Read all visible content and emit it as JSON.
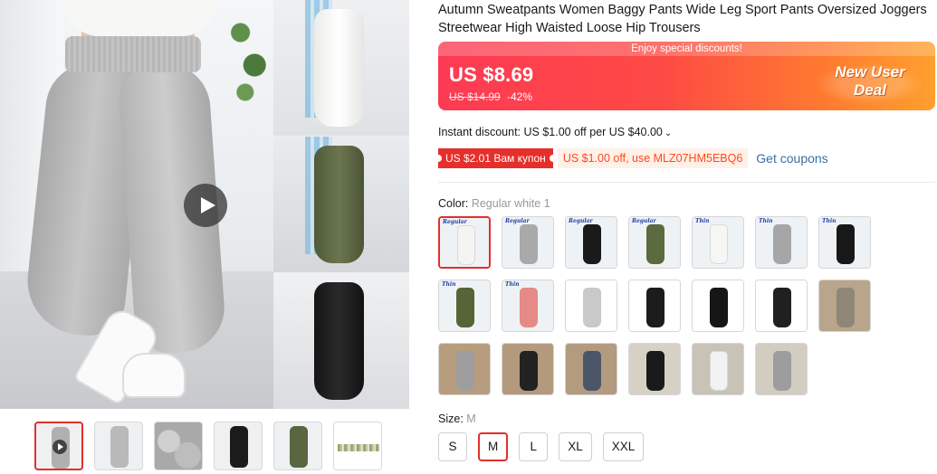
{
  "product": {
    "title": "Autumn Sweatpants Women Baggy Pants Wide Leg Sport Pants Oversized Joggers Streetwear High Waisted Loose Hip Trousers"
  },
  "gallery": {
    "main_image": "grey-sweatpants-model-photo",
    "side_images": [
      "white-sweatpants-photo",
      "olive-sweatpants-photo",
      "black-sweatpants-photo"
    ],
    "thumbnails": [
      "video-thumbnail-grey",
      "grey-pants-thumbnail",
      "fleece-fabric-thumbnail",
      "black-pants-thumbnail",
      "olive-pants-thumbnail",
      "color-swatch-thumbnail"
    ],
    "active_thumbnail": 0
  },
  "price_banner": {
    "header": "Enjoy special discounts!",
    "price": "US $8.69",
    "original_price": "US $14.99",
    "discount": "-42%",
    "badge_line1": "New User",
    "badge_line2": "Deal"
  },
  "discounts": {
    "instant": "Instant discount: US $1.00 off per US $40.00",
    "coupon_red": "US $2.01 Вам купон",
    "coupon_orange": "US $1.00 off, use MLZ07HM5EBQ6",
    "get_coupons": "Get coupons"
  },
  "color": {
    "label": "Color:",
    "selected": "Regular white 1",
    "options": [
      {
        "tag": "Regular",
        "color": "#f4f4f2",
        "bg": "#eef2f4"
      },
      {
        "tag": "Regular",
        "color": "#a9a9a9",
        "bg": "#eef2f4"
      },
      {
        "tag": "Regular",
        "color": "#1a1a1a",
        "bg": "#eef2f4"
      },
      {
        "tag": "Regular",
        "color": "#5b6a3f",
        "bg": "#eef2f4"
      },
      {
        "tag": "Thin",
        "color": "#f6f6f4",
        "bg": "#eef2f4"
      },
      {
        "tag": "Thin",
        "color": "#a6a6a6",
        "bg": "#eef2f4"
      },
      {
        "tag": "Thin",
        "color": "#181818",
        "bg": "#eef2f4"
      },
      {
        "tag": "Thin",
        "color": "#566438",
        "bg": "#eef2f4"
      },
      {
        "tag": "Thin",
        "color": "#e58a86",
        "bg": "#eef2f4"
      },
      {
        "tag": "",
        "color": "#c9c9c9",
        "bg": "#ffffff"
      },
      {
        "tag": "",
        "color": "#1c1c1c",
        "bg": "#ffffff"
      },
      {
        "tag": "",
        "color": "#161616",
        "bg": "#ffffff"
      },
      {
        "tag": "",
        "color": "#202020",
        "bg": "#ffffff"
      },
      {
        "tag": "",
        "color": "#8f8678",
        "bg": "#b9a58c"
      },
      {
        "tag": "",
        "color": "#9e9e9e",
        "bg": "#b79c7e"
      },
      {
        "tag": "",
        "color": "#222222",
        "bg": "#b49a7c"
      },
      {
        "tag": "",
        "color": "#4a5668",
        "bg": "#b39b80"
      },
      {
        "tag": "",
        "color": "#1a1a1a",
        "bg": "#d6d0c6"
      },
      {
        "tag": "",
        "color": "#f2f2f2",
        "bg": "#c9c2b6"
      },
      {
        "tag": "",
        "color": "#9d9d9d",
        "bg": "#d2ccc1"
      }
    ],
    "selected_index": 0
  },
  "size": {
    "label": "Size:",
    "selected": "M",
    "options": [
      "S",
      "M",
      "L",
      "XL",
      "XXL"
    ],
    "selected_index": 1
  },
  "colors": {
    "accent_red": "#e0302c",
    "link_blue": "#3a6ea5",
    "coupon_orange_text": "#fd4b1a"
  }
}
